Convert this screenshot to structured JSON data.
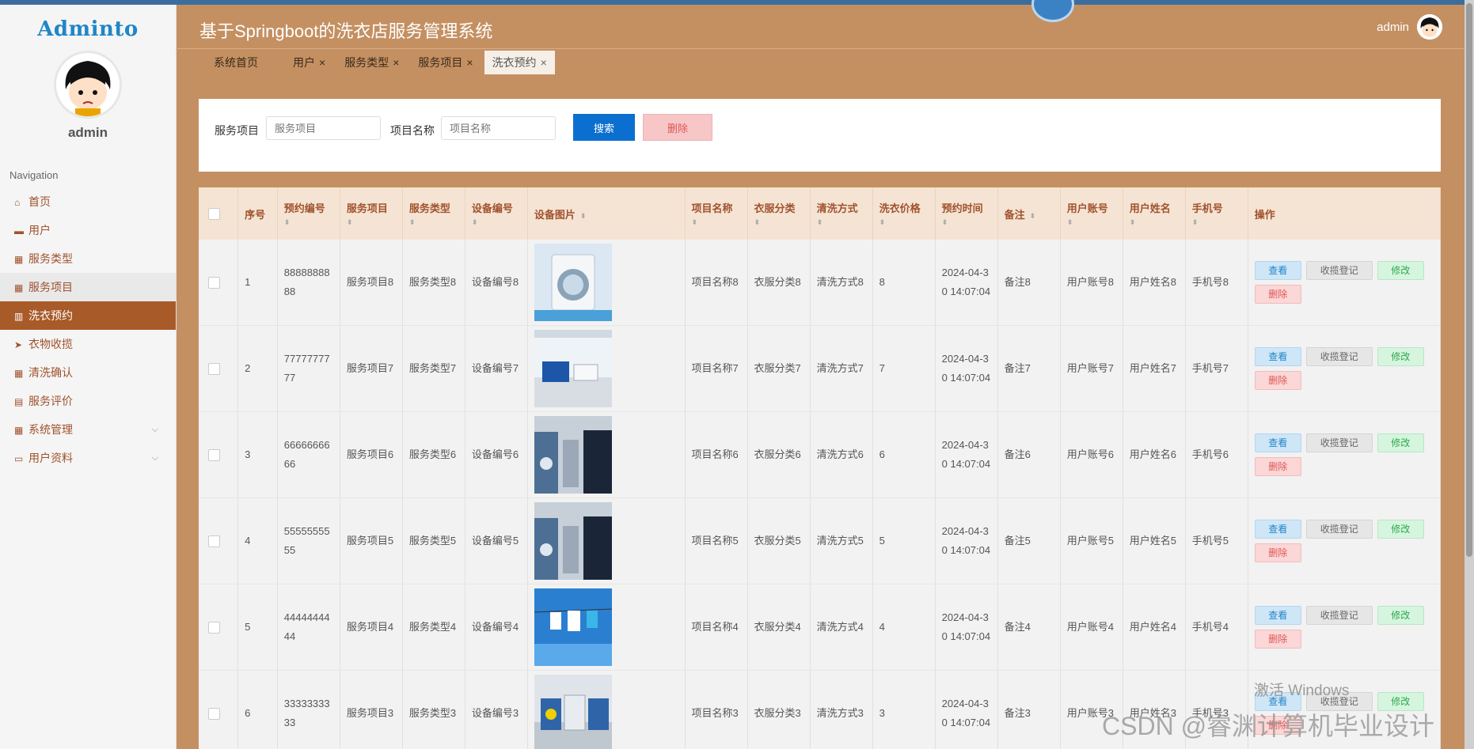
{
  "app": {
    "title": "基于Springboot的洗衣店服务管理系统"
  },
  "sidebar": {
    "logo": "Adminto",
    "username": "admin",
    "nav_title": "Navigation",
    "items": [
      {
        "label": "首页",
        "icon": "home-icon"
      },
      {
        "label": "用户",
        "icon": "monitor-icon"
      },
      {
        "label": "服务类型",
        "icon": "grid-icon"
      },
      {
        "label": "服务项目",
        "icon": "grid-icon"
      },
      {
        "label": "洗衣预约",
        "icon": "columns-icon"
      },
      {
        "label": "衣物收揽",
        "icon": "send-icon"
      },
      {
        "label": "清洗确认",
        "icon": "grid-icon"
      },
      {
        "label": "服务评价",
        "icon": "clipboard-icon"
      },
      {
        "label": "系统管理",
        "icon": "grid-icon"
      },
      {
        "label": "用户资料",
        "icon": "calendar-icon"
      }
    ]
  },
  "header": {
    "user": "admin",
    "close_glyph": "×"
  },
  "tabs": [
    {
      "label": "系统首页",
      "closable": false
    },
    {
      "label": "用户",
      "closable": true
    },
    {
      "label": "服务类型",
      "closable": true
    },
    {
      "label": "服务项目",
      "closable": true
    },
    {
      "label": "洗衣预约",
      "closable": true,
      "active": true
    }
  ],
  "search": {
    "label1": "服务项目",
    "placeholder1": "服务项目",
    "label2": "项目名称",
    "placeholder2": "项目名称",
    "search_btn": "搜索",
    "delete_btn": "删除"
  },
  "table": {
    "columns": [
      "序号",
      "预约编号",
      "服务项目",
      "服务类型",
      "设备编号",
      "设备图片",
      "项目名称",
      "衣服分类",
      "清洗方式",
      "洗衣价格",
      "预约时间",
      "备注",
      "用户账号",
      "用户姓名",
      "手机号",
      "操作"
    ],
    "actions": {
      "view": "查看",
      "register": "收揽登记",
      "edit": "修改",
      "delete": "删除"
    },
    "rows": [
      {
        "no": "1",
        "booking": "8888888888",
        "service": "服务项目8",
        "type": "服务类型8",
        "device": "设备编号8",
        "project": "项目名称8",
        "category": "衣服分类8",
        "wash": "清洗方式8",
        "price": "8",
        "time": "2024-04-30 14:07:04",
        "remark": "备注8",
        "account": "用户账号8",
        "name": "用户姓名8",
        "phone": "手机号8"
      },
      {
        "no": "2",
        "booking": "7777777777",
        "service": "服务项目7",
        "type": "服务类型7",
        "device": "设备编号7",
        "project": "项目名称7",
        "category": "衣服分类7",
        "wash": "清洗方式7",
        "price": "7",
        "time": "2024-04-30 14:07:04",
        "remark": "备注7",
        "account": "用户账号7",
        "name": "用户姓名7",
        "phone": "手机号7"
      },
      {
        "no": "3",
        "booking": "6666666666",
        "service": "服务项目6",
        "type": "服务类型6",
        "device": "设备编号6",
        "project": "项目名称6",
        "category": "衣服分类6",
        "wash": "清洗方式6",
        "price": "6",
        "time": "2024-04-30 14:07:04",
        "remark": "备注6",
        "account": "用户账号6",
        "name": "用户姓名6",
        "phone": "手机号6"
      },
      {
        "no": "4",
        "booking": "5555555555",
        "service": "服务项目5",
        "type": "服务类型5",
        "device": "设备编号5",
        "project": "项目名称5",
        "category": "衣服分类5",
        "wash": "清洗方式5",
        "price": "5",
        "time": "2024-04-30 14:07:04",
        "remark": "备注5",
        "account": "用户账号5",
        "name": "用户姓名5",
        "phone": "手机号5"
      },
      {
        "no": "5",
        "booking": "4444444444",
        "service": "服务项目4",
        "type": "服务类型4",
        "device": "设备编号4",
        "project": "项目名称4",
        "category": "衣服分类4",
        "wash": "清洗方式4",
        "price": "4",
        "time": "2024-04-30 14:07:04",
        "remark": "备注4",
        "account": "用户账号4",
        "name": "用户姓名4",
        "phone": "手机号4"
      },
      {
        "no": "6",
        "booking": "3333333333",
        "service": "服务项目3",
        "type": "服务类型3",
        "device": "设备编号3",
        "project": "项目名称3",
        "category": "衣服分类3",
        "wash": "清洗方式3",
        "price": "3",
        "time": "2024-04-30 14:07:04",
        "remark": "备注3",
        "account": "用户账号3",
        "name": "用户姓名3",
        "phone": "手机号3"
      }
    ]
  },
  "overlay": {
    "windows_watermark": "激活 Windows",
    "csdn_watermark": "CSDN @睿渊计算机毕业设计"
  },
  "colors": {
    "header_bg": "#c49062",
    "sidebar_active": "#a85a28",
    "primary": "#0b6fcf",
    "danger": "#e05555",
    "success": "#2fa84f"
  }
}
